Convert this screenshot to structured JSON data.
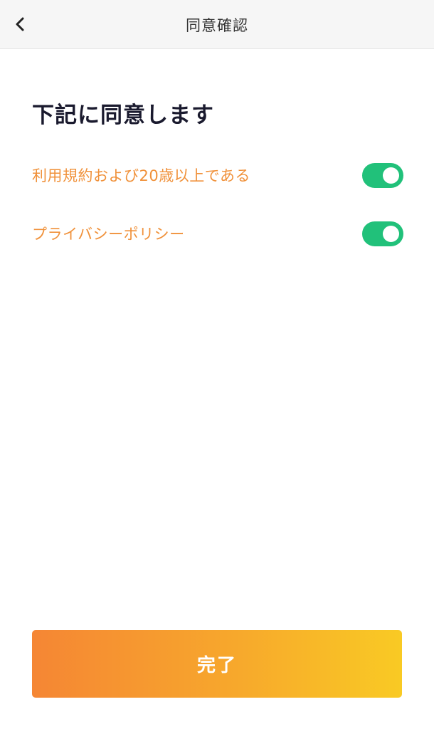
{
  "header": {
    "title": "同意確認",
    "back_icon": "chevron-left-icon"
  },
  "main": {
    "heading": "下記に同意します",
    "agreements": [
      {
        "label": "利用規約および20歳以上である",
        "enabled": true
      },
      {
        "label": "プライバシーポリシー",
        "enabled": true
      }
    ]
  },
  "footer": {
    "done_label": "完了"
  },
  "colors": {
    "accent_text": "#f0913a",
    "toggle_on": "#21c17a",
    "button_gradient_start": "#f58634",
    "button_gradient_end": "#f9ca24",
    "heading_text": "#1a1a2e"
  }
}
